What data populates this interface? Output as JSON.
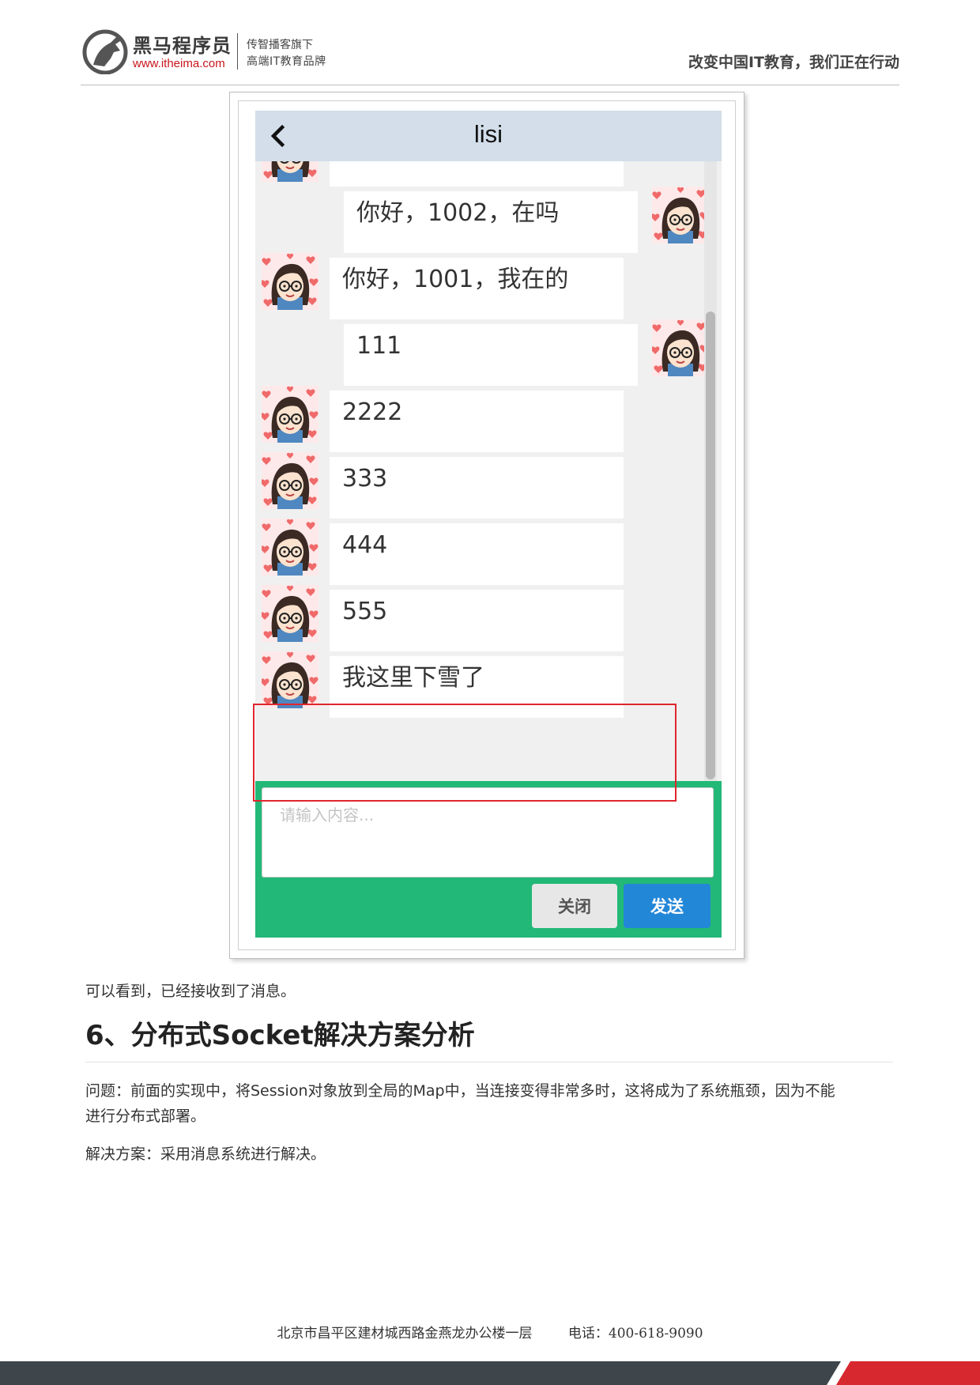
{
  "header": {
    "brand_name": "黑马程序员",
    "brand_url": "www.itheima.com",
    "sub_line1": "传智播客旗下",
    "sub_line2": "高端IT教育品牌",
    "slogan": "改变中国IT教育，我们正在行动"
  },
  "chat": {
    "title": "lisi",
    "messages": [
      {
        "side": "left",
        "text": ""
      },
      {
        "side": "right",
        "text": "你好，1002，在吗"
      },
      {
        "side": "left",
        "text": "你好，1001，我在的"
      },
      {
        "side": "right",
        "text": "111"
      },
      {
        "side": "left",
        "text": "2222"
      },
      {
        "side": "left",
        "text": "333"
      },
      {
        "side": "left",
        "text": "444"
      },
      {
        "side": "left",
        "text": "555"
      },
      {
        "side": "left",
        "text": "我这里下雪了"
      }
    ],
    "input_placeholder": "请输入内容...",
    "close_label": "关闭",
    "send_label": "发送",
    "colors": {
      "titlebar": "#d3deea",
      "inputbar": "#22b877",
      "send": "#2387d8",
      "highlight": "#e0262e"
    }
  },
  "body": {
    "caption": "可以看到，已经接收到了消息。",
    "heading": "6、分布式Socket解决方案分析",
    "problem_line1": "问题：前面的实现中，将Session对象放到全局的Map中，当连接变得非常多时，这将成为了系统瓶颈，因为不能",
    "problem_line2": "进行分布式部署。",
    "solution": "解决方案：采用消息系统进行解决。"
  },
  "footer": {
    "address": "北京市昌平区建材城西路金燕龙办公楼一层",
    "phone": "电话：400-618-9090"
  }
}
